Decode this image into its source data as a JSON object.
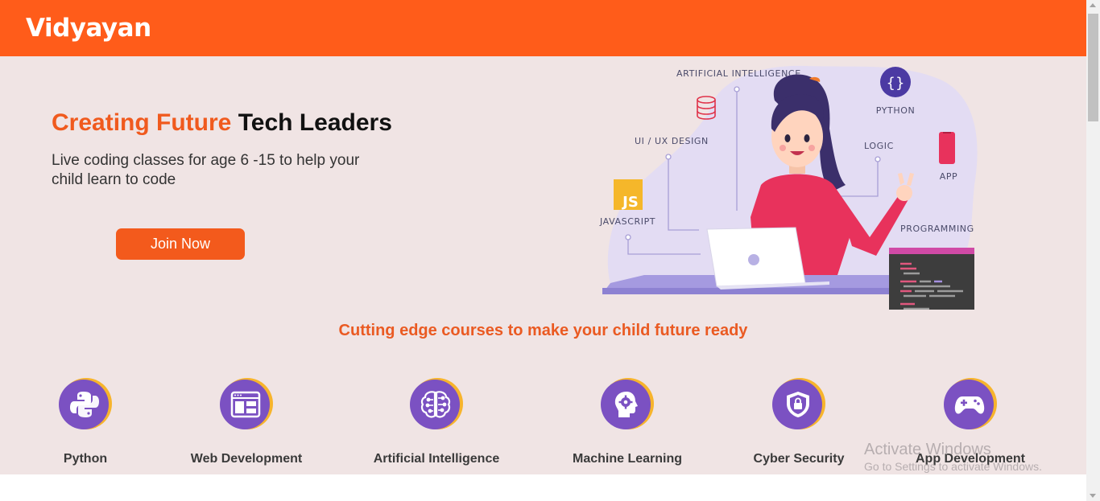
{
  "navbar": {
    "brand": "Vidyayan"
  },
  "hero": {
    "title_accent": "Creating Future",
    "title_rest": "Tech Leaders",
    "subtitle": "Live coding classes for age 6 -15 to help your child learn to code",
    "cta_label": "Join Now"
  },
  "illustration": {
    "labels": {
      "ai": "ARTIFICIAL INTELLIGENCE",
      "python": "PYTHON",
      "uiux": "UI / UX DESIGN",
      "logic": "LOGIC",
      "app": "APP",
      "javascript": "JAVASCRIPT",
      "programming": "PROGRAMMING",
      "js_badge": "JS",
      "braces": "{}"
    }
  },
  "courses": {
    "heading": "Cutting edge courses to make your child future ready",
    "items": [
      {
        "label": "Python",
        "icon": "python-icon"
      },
      {
        "label": "Web Development",
        "icon": "browser-window-icon"
      },
      {
        "label": "Artificial Intelligence",
        "icon": "brain-circuit-icon"
      },
      {
        "label": "Machine Learning",
        "icon": "head-gear-icon"
      },
      {
        "label": "Cyber Security",
        "icon": "shield-lock-icon"
      },
      {
        "label": "App Development",
        "icon": "gamepad-icon"
      }
    ]
  },
  "watermark": {
    "title": "Activate Windows",
    "subtitle": "Go to Settings to activate Windows."
  },
  "colors": {
    "brand_orange": "#ff5c1a",
    "hero_bg": "#f0e4e4",
    "icon_purple": "#7b51c2",
    "icon_ring": "#f7b42c"
  }
}
